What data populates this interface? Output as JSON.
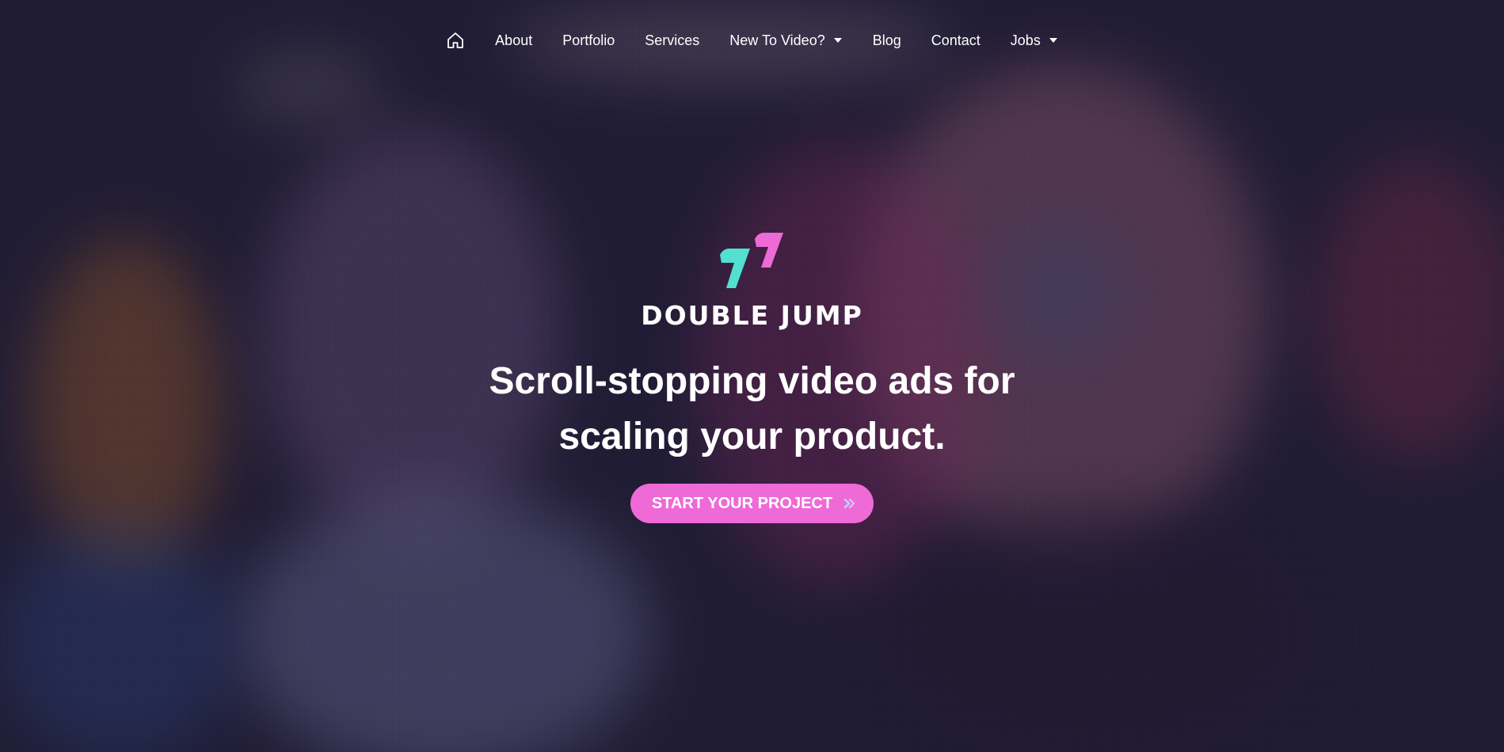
{
  "nav": {
    "items": [
      {
        "label": "About"
      },
      {
        "label": "Portfolio"
      },
      {
        "label": "Services"
      },
      {
        "label": "New To Video?"
      },
      {
        "label": "Blog"
      },
      {
        "label": "Contact"
      },
      {
        "label": "Jobs"
      }
    ],
    "icons": {
      "home": "home-icon",
      "dropdown": "caret-down-icon"
    }
  },
  "hero": {
    "brand": "DOUBLE JUMP",
    "headline_line1": "Scroll-stopping video ads for",
    "headline_line2": "scaling your product.",
    "cta_label": "START YOUR PROJECT",
    "cta_icon": "double-chevron-right-icon"
  },
  "colors": {
    "accent_pink": "#ee6ad6",
    "accent_teal": "#52e0d0",
    "text": "#ffffff"
  }
}
